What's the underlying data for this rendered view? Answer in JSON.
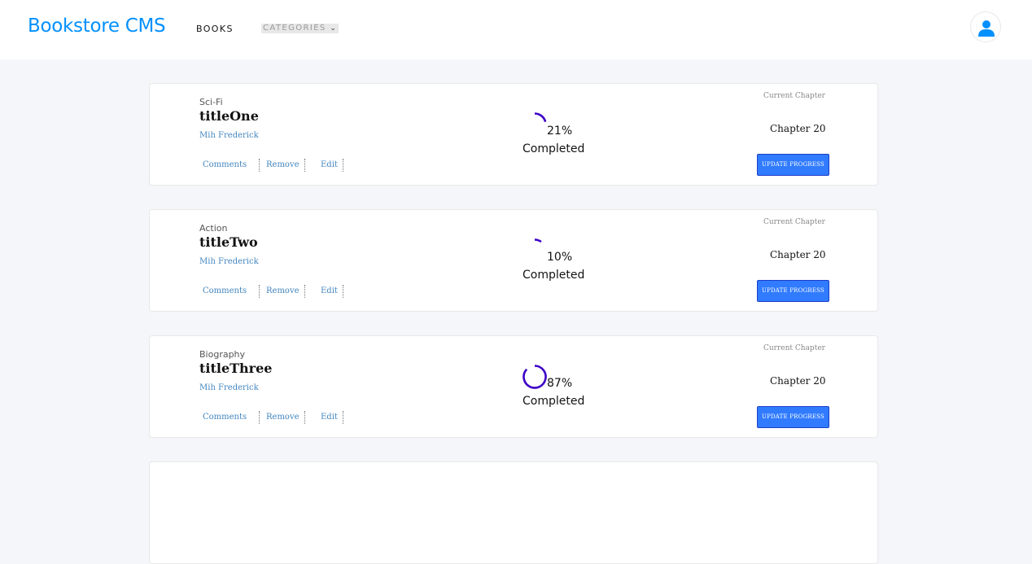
{
  "header": {
    "brand": "Bookstore CMS",
    "nav": {
      "books": "BOOKS",
      "categories": "CATEGORIES"
    }
  },
  "books": [
    {
      "genre": "Sci-Fi",
      "title": "titleOne",
      "author": "Mih Frederick",
      "actions": [
        "Comments",
        "Remove",
        "Edit"
      ],
      "progress": 0.21,
      "percent": "21%",
      "completed": "Completed",
      "current_label": "Current Chapter",
      "chapter": "Chapter 20",
      "update_label": "UPDATE PROGRESS"
    },
    {
      "genre": "Action",
      "title": "titleTwo",
      "author": "Mih Frederick",
      "actions": [
        "Comments",
        "Remove",
        "Edit"
      ],
      "progress": 0.1,
      "percent": "10%",
      "completed": "Completed",
      "current_label": "Current Chapter",
      "chapter": "Chapter 20",
      "update_label": "UPDATE PROGRESS"
    },
    {
      "genre": "Biography",
      "title": "titleThree",
      "author": "Mih Frederick",
      "actions": [
        "Comments",
        "Remove",
        "Edit"
      ],
      "progress": 0.87,
      "percent": "87%",
      "completed": "Completed",
      "current_label": "Current Chapter",
      "chapter": "Chapter 20",
      "update_label": "UPDATE PROGRESS"
    }
  ],
  "colors": {
    "brand": "#0290ff",
    "progress_arc": "#3c00c6",
    "button": "#307bff"
  },
  "icons": {
    "avatar": "user-icon",
    "categories_toggle": "chevron-down-icon"
  }
}
